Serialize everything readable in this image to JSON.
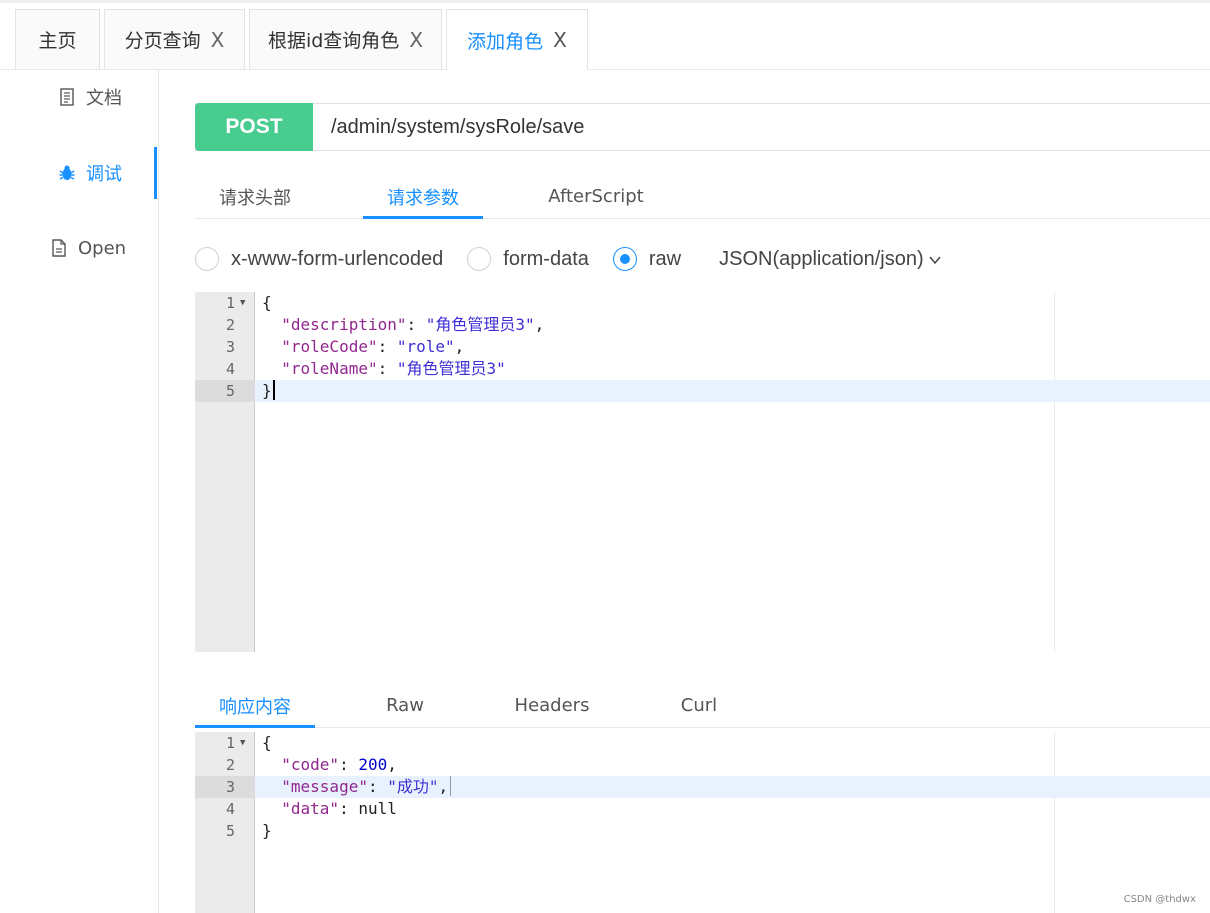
{
  "top_tabs": [
    {
      "label": "主页",
      "closable": false
    },
    {
      "label": "分页查询",
      "closable": true
    },
    {
      "label": "根据id查询角色",
      "closable": true
    },
    {
      "label": "添加角色",
      "closable": true,
      "active": true
    }
  ],
  "close_glyph": "X",
  "sidebar": {
    "items": [
      {
        "label": "文档",
        "icon": "document-icon"
      },
      {
        "label": "调试",
        "icon": "bug-icon",
        "active": true
      },
      {
        "label": "Open",
        "icon": "file-icon"
      }
    ]
  },
  "request": {
    "method": "POST",
    "method_color": "#49cc90",
    "url": "/admin/system/sysRole/save"
  },
  "request_tabs": [
    "请求头部",
    "请求参数",
    "AfterScript"
  ],
  "request_active_tab": "请求参数",
  "body_types": [
    {
      "label": "x-www-form-urlencoded",
      "checked": false
    },
    {
      "label": "form-data",
      "checked": false
    },
    {
      "label": "raw",
      "checked": true
    }
  ],
  "content_type": "JSON(application/json)",
  "request_editor": {
    "lines": [
      "1",
      "2",
      "3",
      "4",
      "5"
    ],
    "highlighted_line": 5
  },
  "request_body": {
    "open": "{",
    "description_key": "\"description\"",
    "description_value": "\"角色管理员3\"",
    "roleCode_key": "\"roleCode\"",
    "roleCode_value": "\"role\"",
    "roleName_key": "\"roleName\"",
    "roleName_value": "\"角色管理员3\"",
    "close": "}"
  },
  "response_tabs": [
    "响应内容",
    "Raw",
    "Headers",
    "Curl"
  ],
  "response_active_tab": "响应内容",
  "response_editor": {
    "lines": [
      "1",
      "2",
      "3",
      "4",
      "5"
    ],
    "highlighted_line": 3
  },
  "response_body": {
    "open": "{",
    "code_key": "\"code\"",
    "code_value": "200",
    "message_key": "\"message\"",
    "message_value": "\"成功\"",
    "data_key": "\"data\"",
    "data_value": "null",
    "close": "}"
  },
  "watermark": "CSDN @thdwx",
  "accent_color": "#1890ff"
}
